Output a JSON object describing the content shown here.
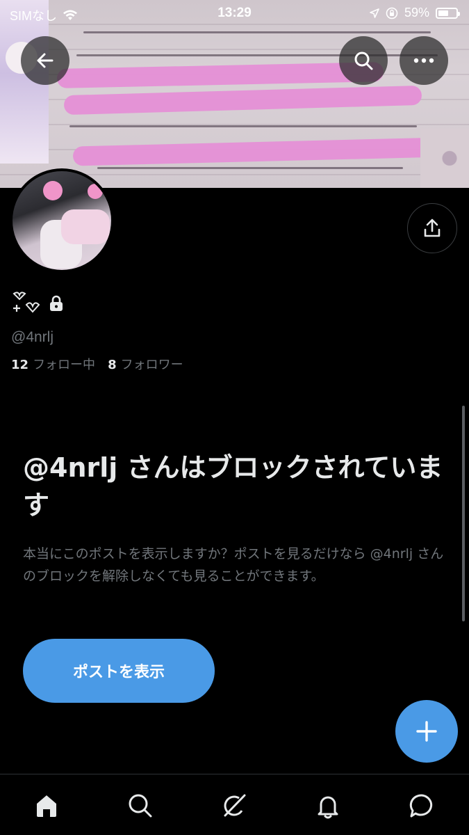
{
  "status_bar": {
    "carrier": "SIMなし",
    "time": "13:29",
    "battery_percent": "59%",
    "battery_level": 0.59
  },
  "header": {
    "back_icon": "arrow-left-icon",
    "search_icon": "search-icon",
    "more_icon": "more-horizontal-icon"
  },
  "profile": {
    "display_name_icons": [
      "heart-sparkle-icon",
      "lock-icon"
    ],
    "handle": "@4nrlj",
    "following_count": "12",
    "following_label": "フォロー中",
    "followers_count": "8",
    "followers_label": "フォロワー"
  },
  "blocked": {
    "title": "@4nrlj さんはブロックされています",
    "description": "本当にこのポストを表示しますか？ポストを見るだけなら @4nrlj さんのブロックを解除しなくても見ることができます。",
    "button_label": "ポストを表示"
  },
  "colors": {
    "accent": "#4a9ae6",
    "background": "#000000",
    "muted_text": "#71767b",
    "banner_scribble": "#e58fd6"
  },
  "tab_bar": {
    "items": [
      "home-icon",
      "search-icon",
      "grok-icon",
      "notifications-icon",
      "messages-icon"
    ]
  }
}
